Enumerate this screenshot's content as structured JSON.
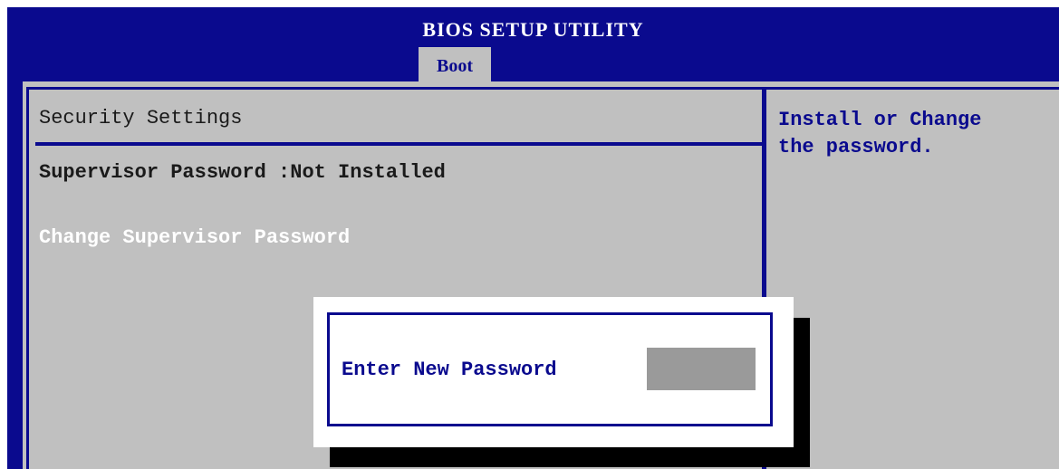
{
  "header": {
    "title": "BIOS SETUP UTILITY",
    "active_tab": "Boot"
  },
  "main": {
    "section_title": "Security Settings",
    "supervisor_password": {
      "label": "Supervisor Password",
      "separator": " :",
      "value": "Not Installed"
    },
    "change_item": "Change Supervisor Password"
  },
  "help": {
    "text": "Install or Change\nthe password."
  },
  "dialog": {
    "label": "Enter New Password",
    "input_value": ""
  },
  "colors": {
    "bios_blue": "#0a0a8e",
    "panel_gray": "#c0c0c0",
    "input_gray": "#9a9a9a",
    "selected_text": "#ffffff"
  }
}
